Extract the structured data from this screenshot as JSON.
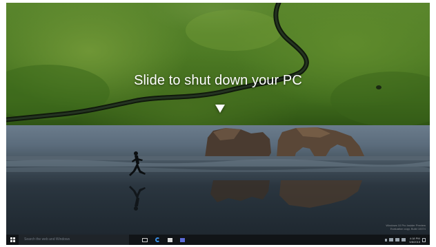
{
  "slide_to_shutdown": {
    "message": "Slide to shut down your PC",
    "arrow_icon": "down-triangle-icon"
  },
  "desktop": {
    "wallpaper": "beach-runner-wallpaper",
    "watermark_line1": "Windows 10 Pro Insider Preview",
    "watermark_line2": "Evaluation copy. Build 10074"
  },
  "taskbar": {
    "start_icon": "windows-logo-icon",
    "search_placeholder": "Search the web and Windows",
    "icons": [
      "task-view-icon",
      "edge-icon",
      "file-explorer-icon",
      "store-icon"
    ],
    "clock_time": "4:18 PM",
    "clock_date": "5/8/2015",
    "background_color": "#111417"
  }
}
